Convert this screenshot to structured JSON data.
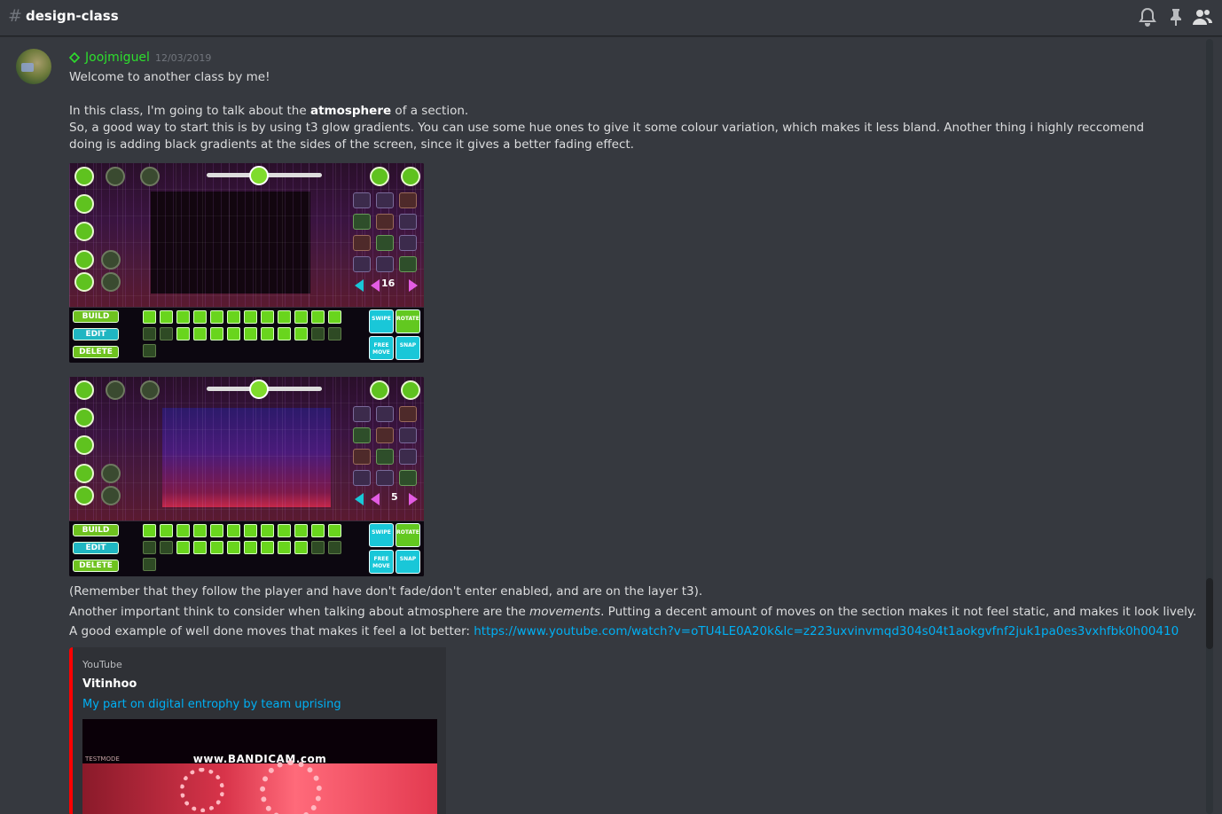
{
  "header": {
    "hash": "#",
    "channel_name": "design-class",
    "icons": [
      "notification-bell-icon",
      "pin-icon",
      "member-list-icon"
    ]
  },
  "message": {
    "username": "Joojmiguel",
    "username_color": "#2ddf2d",
    "badge_icon": "diamond-badge-icon",
    "timestamp": "12/03/2019",
    "line1": "Welcome to another class by me!",
    "line2_pre": "In this class, I'm going to talk about the ",
    "line2_bold": "atmosphere",
    "line2_post": " of a section.",
    "line3": "So, a good way to start this is by using t3 glow gradients. You can use some hue ones to give it some colour variation, which makes it less bland. Another thing i highly reccomend doing is adding black gradients at the sides of the screen, since it gives a better fading effect.",
    "line4": "(Remember that they follow the player and have don't fade/don't enter enabled, and are on the layer t3).",
    "line5_pre": "Another important think to consider when talking about atmosphere are the ",
    "line5_ital": "movements",
    "line5_post": ".  Putting a decent amount of moves on the section makes it not feel static, and makes it look lively.",
    "line6_pre": "A good example of well done moves that makes it feel a lot better: ",
    "line6_link": "https://www.youtube.com/watch?v=oTU4LE0A20k&lc=z223uxvinvmqd304s04t1aokgvfnf2juk1pa0es3vxhfbk0h00410"
  },
  "screenshots": [
    {
      "layer_number": "16",
      "mode_buttons": [
        "BUILD",
        "EDIT",
        "DELETE"
      ],
      "side_buttons": [
        "SWIPE",
        "ROTATE",
        "FREE MOVE",
        "SNAP"
      ]
    },
    {
      "layer_number": "5",
      "mode_buttons": [
        "BUILD",
        "EDIT",
        "DELETE"
      ],
      "side_buttons": [
        "SWIPE",
        "ROTATE",
        "FREE MOVE",
        "SNAP"
      ]
    }
  ],
  "embed": {
    "provider": "YouTube",
    "author": "Vitinhoo",
    "title": "My part on digital entrophy by team uprising",
    "thumbnail_watermark": "www.BANDICAM.com",
    "thumbnail_label": "TESTMODE",
    "border_color": "#ff0000"
  },
  "colors": {
    "background": "#36393f",
    "link": "#00b0f4",
    "text": "#dcddde"
  }
}
